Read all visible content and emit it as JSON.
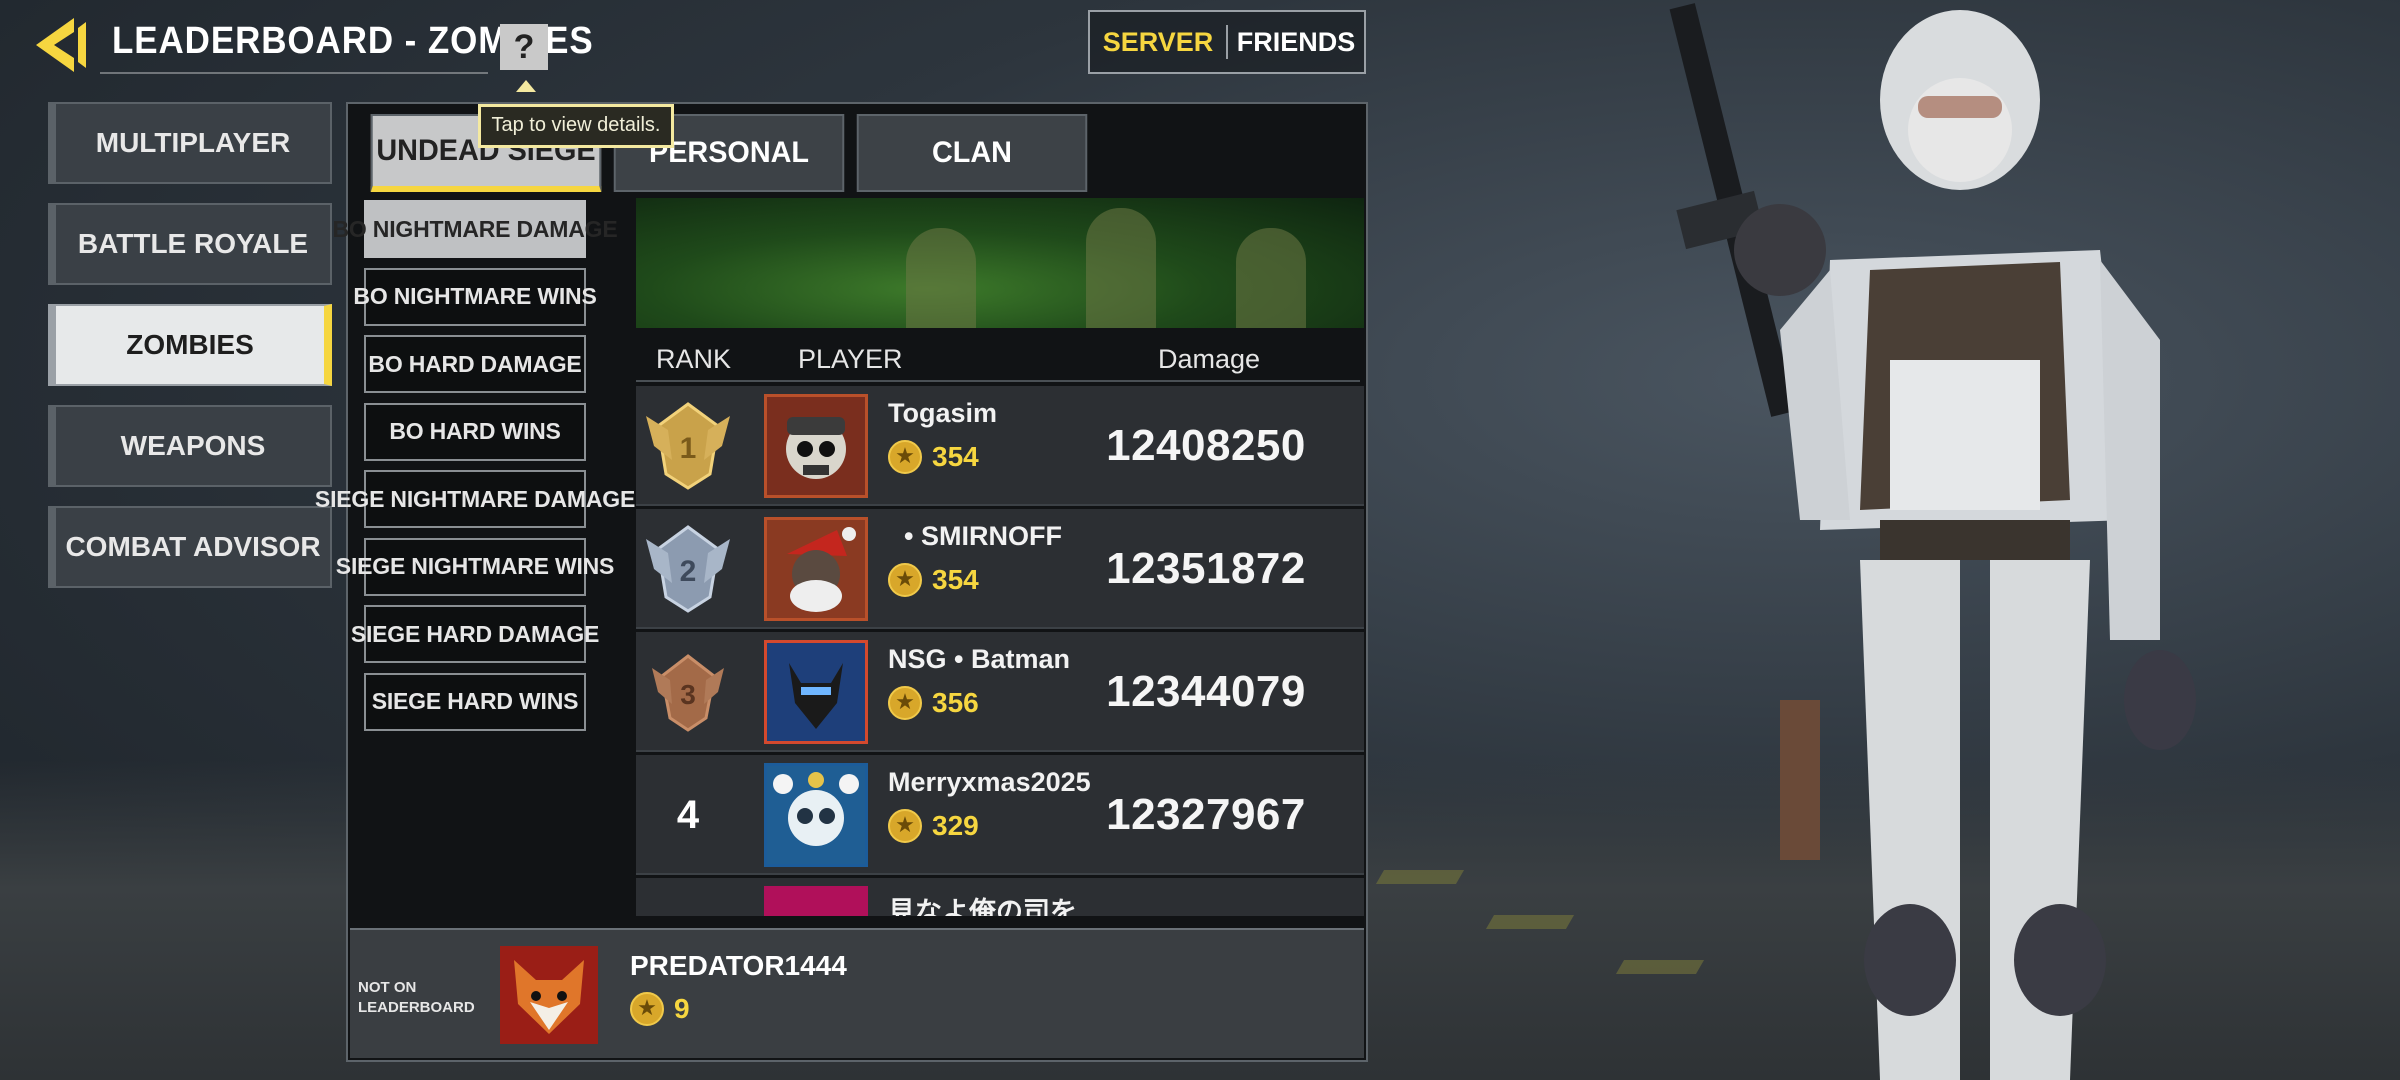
{
  "header": {
    "title": "LEADERBOARD - ZOMBIES",
    "help_label": "?",
    "tooltip": "Tap to view details."
  },
  "scope_toggle": {
    "options": [
      "SERVER",
      "FRIENDS"
    ],
    "selected": "SERVER"
  },
  "categories": [
    {
      "label": "MULTIPLAYER",
      "active": false
    },
    {
      "label": "BATTLE ROYALE",
      "active": false
    },
    {
      "label": "ZOMBIES",
      "active": true
    },
    {
      "label": "WEAPONS",
      "active": false
    },
    {
      "label": "COMBAT ADVISOR",
      "active": false
    }
  ],
  "mode_tabs": [
    {
      "label": "UNDEAD SIEGE",
      "active": true
    },
    {
      "label": "PERSONAL",
      "active": false
    },
    {
      "label": "CLAN",
      "active": false
    }
  ],
  "sub_categories": [
    {
      "label": "BO NIGHTMARE DAMAGE",
      "active": true
    },
    {
      "label": "BO NIGHTMARE WINS",
      "active": false
    },
    {
      "label": "BO HARD DAMAGE",
      "active": false
    },
    {
      "label": "BO HARD WINS",
      "active": false
    },
    {
      "label": "SIEGE NIGHTMARE DAMAGE",
      "active": false
    },
    {
      "label": "SIEGE NIGHTMARE WINS",
      "active": false
    },
    {
      "label": "SIEGE HARD DAMAGE",
      "active": false
    },
    {
      "label": "SIEGE HARD WINS",
      "active": false
    }
  ],
  "columns": {
    "rank": "RANK",
    "player": "PLAYER",
    "damage": "Damage"
  },
  "rows": [
    {
      "rank": "1",
      "name": "Togasim",
      "level": "354",
      "damage": "12408250"
    },
    {
      "rank": "2",
      "name": "• SMIRNOFF",
      "level": "354",
      "damage": "12351872"
    },
    {
      "rank": "3",
      "name": "NSG • Batman",
      "level": "356",
      "damage": "12344079"
    },
    {
      "rank": "4",
      "name": "Merryxmas2025",
      "level": "329",
      "damage": "12327967"
    },
    {
      "rank": "",
      "name": "見なよ俺の司を",
      "level": "",
      "damage": ""
    }
  ],
  "me": {
    "status": "NOT ON LEADERBOARD",
    "status_line1": "NOT ON",
    "status_line2": "LEADERBOARD",
    "name": "PREDATOR1444",
    "level": "9"
  },
  "colors": {
    "accent": "#f6d640",
    "panel": "#111315",
    "row": "#2c2f33"
  }
}
